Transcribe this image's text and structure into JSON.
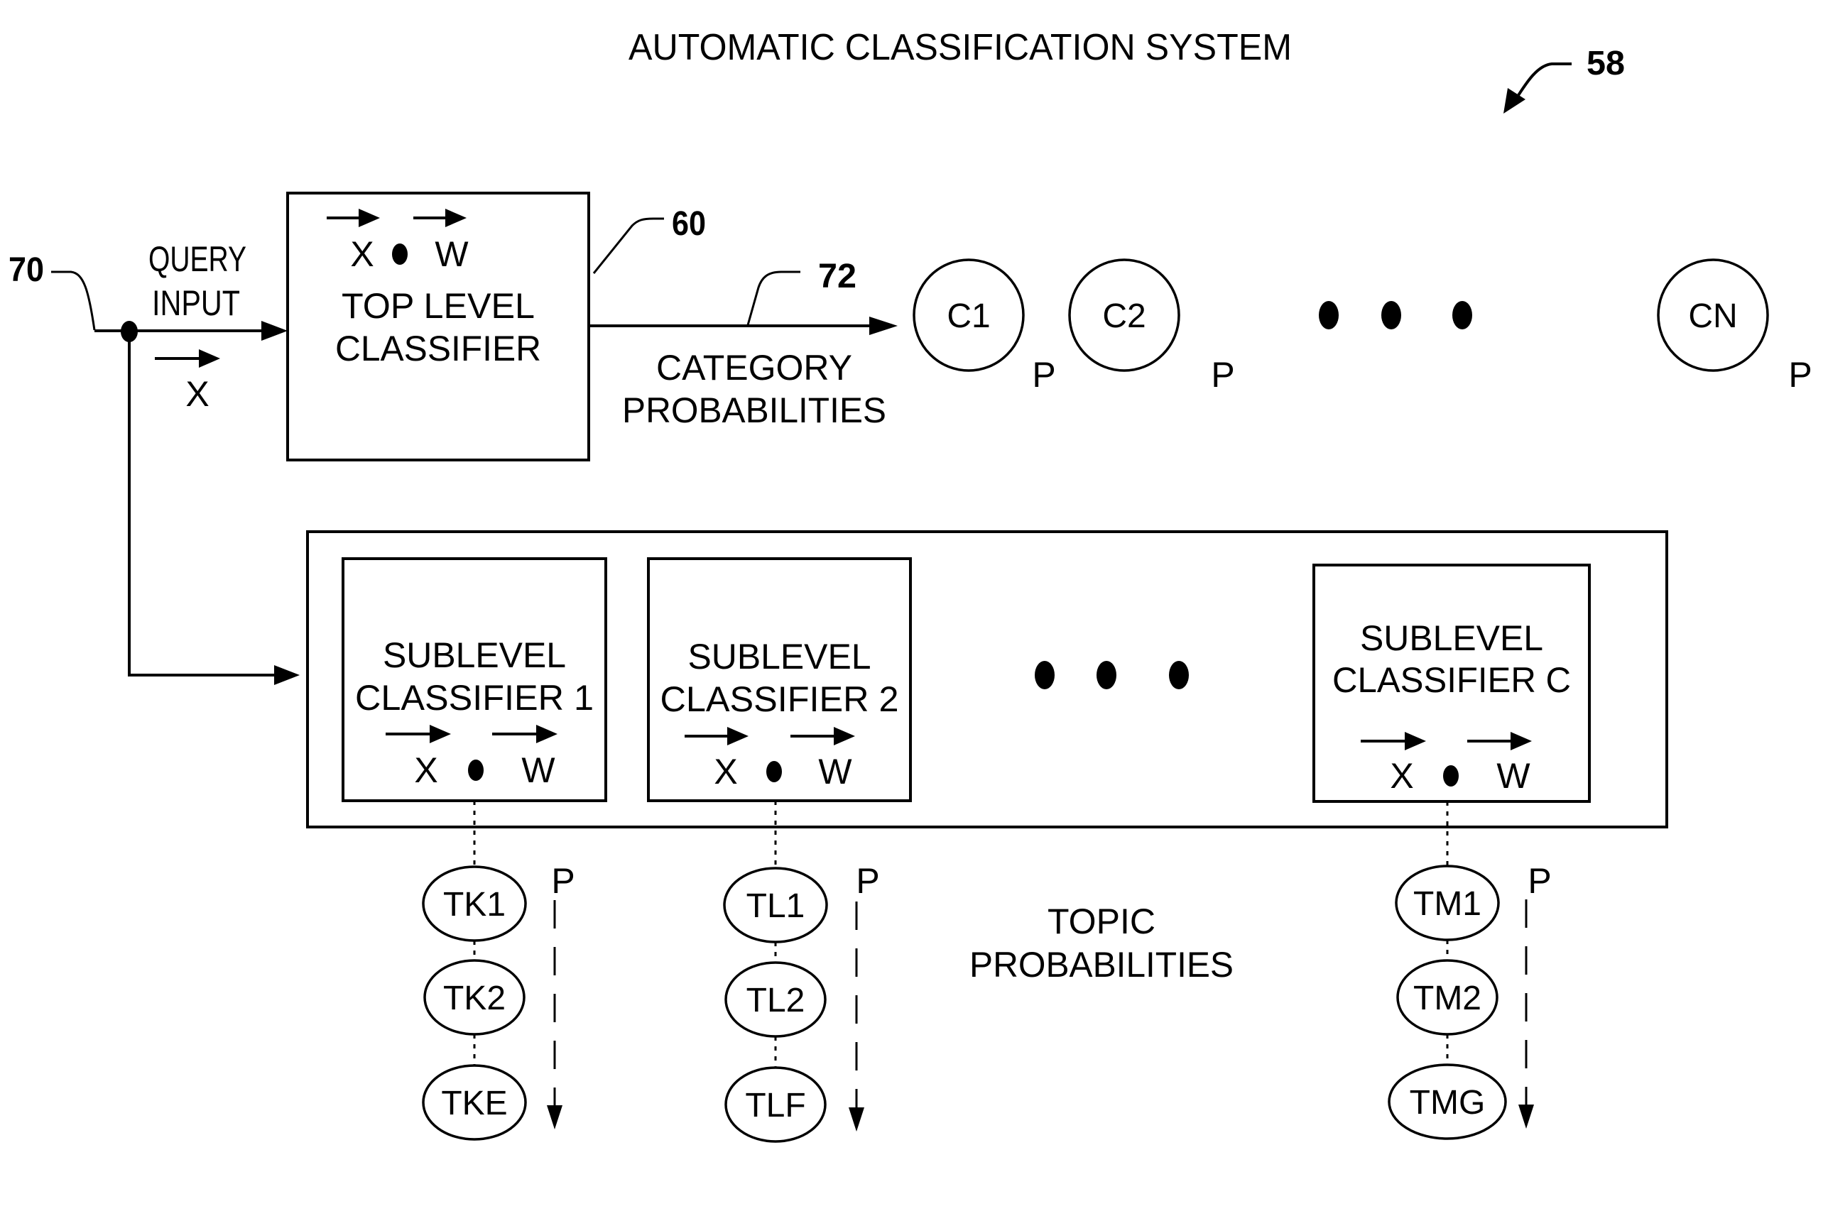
{
  "title": "AUTOMATIC CLASSIFICATION SYSTEM",
  "reference_numerals": {
    "system": "58",
    "top_classifier": "60",
    "query_input": "70",
    "category_output": "72"
  },
  "query_input": {
    "label_line1": "QUERY",
    "label_line2": "INPUT",
    "vector_label": "X"
  },
  "top_level_classifier": {
    "vector_x": "X",
    "vector_w": "W",
    "label_line1": "TOP LEVEL",
    "label_line2": "CLASSIFIER"
  },
  "category_probabilities": {
    "label_line1": "CATEGORY",
    "label_line2": "PROBABILITIES",
    "categories": [
      {
        "label": "C1",
        "prob_label": "P"
      },
      {
        "label": "C2",
        "prob_label": "P"
      },
      {
        "label": "CN",
        "prob_label": "P"
      }
    ],
    "ellipsis": "• • •"
  },
  "sublevel_classifiers": [
    {
      "label_line1": "SUBLEVEL",
      "label_line2": "CLASSIFIER 1",
      "vector_x": "X",
      "vector_w": "W",
      "topics": [
        "TK1",
        "TK2",
        "TKE"
      ],
      "prob_label": "P"
    },
    {
      "label_line1": "SUBLEVEL",
      "label_line2": "CLASSIFIER 2",
      "vector_x": "X",
      "vector_w": "W",
      "topics": [
        "TL1",
        "TL2",
        "TLF"
      ],
      "prob_label": "P"
    },
    {
      "label_line1": "SUBLEVEL",
      "label_line2": "CLASSIFIER C",
      "vector_x": "X",
      "vector_w": "W",
      "topics": [
        "TM1",
        "TM2",
        "TMG"
      ],
      "prob_label": "P"
    }
  ],
  "topic_probabilities": {
    "label_line1": "TOPIC",
    "label_line2": "PROBABILITIES"
  }
}
